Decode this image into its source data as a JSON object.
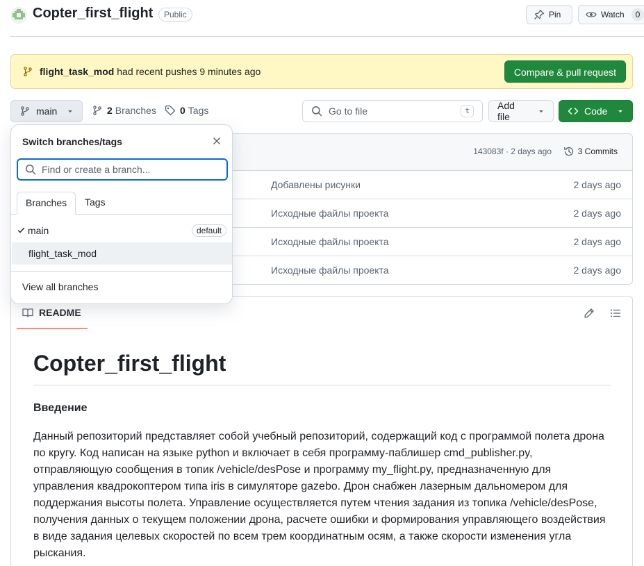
{
  "repo": {
    "name": "Copter_first_flight",
    "visibility": "Public"
  },
  "header_actions": {
    "pin_label": "Pin",
    "watch_label": "Watch",
    "watch_count": "0"
  },
  "banner": {
    "branch": "flight_task_mod",
    "message": " had recent pushes 9 minutes ago",
    "button_label": "Compare & pull request"
  },
  "toolbar": {
    "branch_label": "main",
    "branches_count": "2",
    "branches_label": "Branches",
    "tags_count": "0",
    "tags_label": "Tags",
    "goto_placeholder": "Go to file",
    "goto_shortcut": "t",
    "add_file_label": "Add file",
    "code_label": "Code"
  },
  "commit_header": {
    "meta": "143083f · 2 days ago",
    "commits_label": "3 Commits"
  },
  "files": [
    {
      "message": "Добавлены рисунки",
      "time": "2 days ago"
    },
    {
      "message": "Исходные файлы проекта",
      "time": "2 days ago"
    },
    {
      "message": "Исходные файлы проекта",
      "time": "2 days ago"
    },
    {
      "message": "Исходные файлы проекта",
      "time": "2 days ago"
    }
  ],
  "readme": {
    "tab_label": "README",
    "title": "Copter_first_flight",
    "section_title": "Введение",
    "paragraph": "Данный репозиторий представляет собой учебный репозиторий, содержащий код с программой полета дрона по кругу. Код написан на языке python и включает в себя программу-паблишер cmd_publisher.py, отправляющую сообщения в топик /vehicle/desPose и программу my_flight.py, предназначенную для управления квадрокоптером типа iris в симуляторе gazebo. Дрон снабжен лазерным дальномером для поддержания высоты полета. Управление осуществляется путем чтения задания из топика /vehicle/desPose, получения данных о текущем положении дрона, расчете ошибки и формирования управляющего воздействия в виде задания целевых скоростей по всем трем координатным осям, а также скорости изменения угла рыскания."
  },
  "branch_dropdown": {
    "title": "Switch branches/tags",
    "search_placeholder": "Find or create a branch...",
    "tabs": [
      "Branches",
      "Tags"
    ],
    "branches": [
      {
        "name": "main",
        "badge": "default",
        "selected": true
      },
      {
        "name": "flight_task_mod",
        "badge": "",
        "selected": false
      }
    ],
    "footer_link": "View all branches"
  },
  "colors": {
    "primary_green": "#1f883d",
    "banner_bg": "#fff8c5",
    "focus_blue": "#0969da",
    "underline_orange": "#fd8c73"
  }
}
